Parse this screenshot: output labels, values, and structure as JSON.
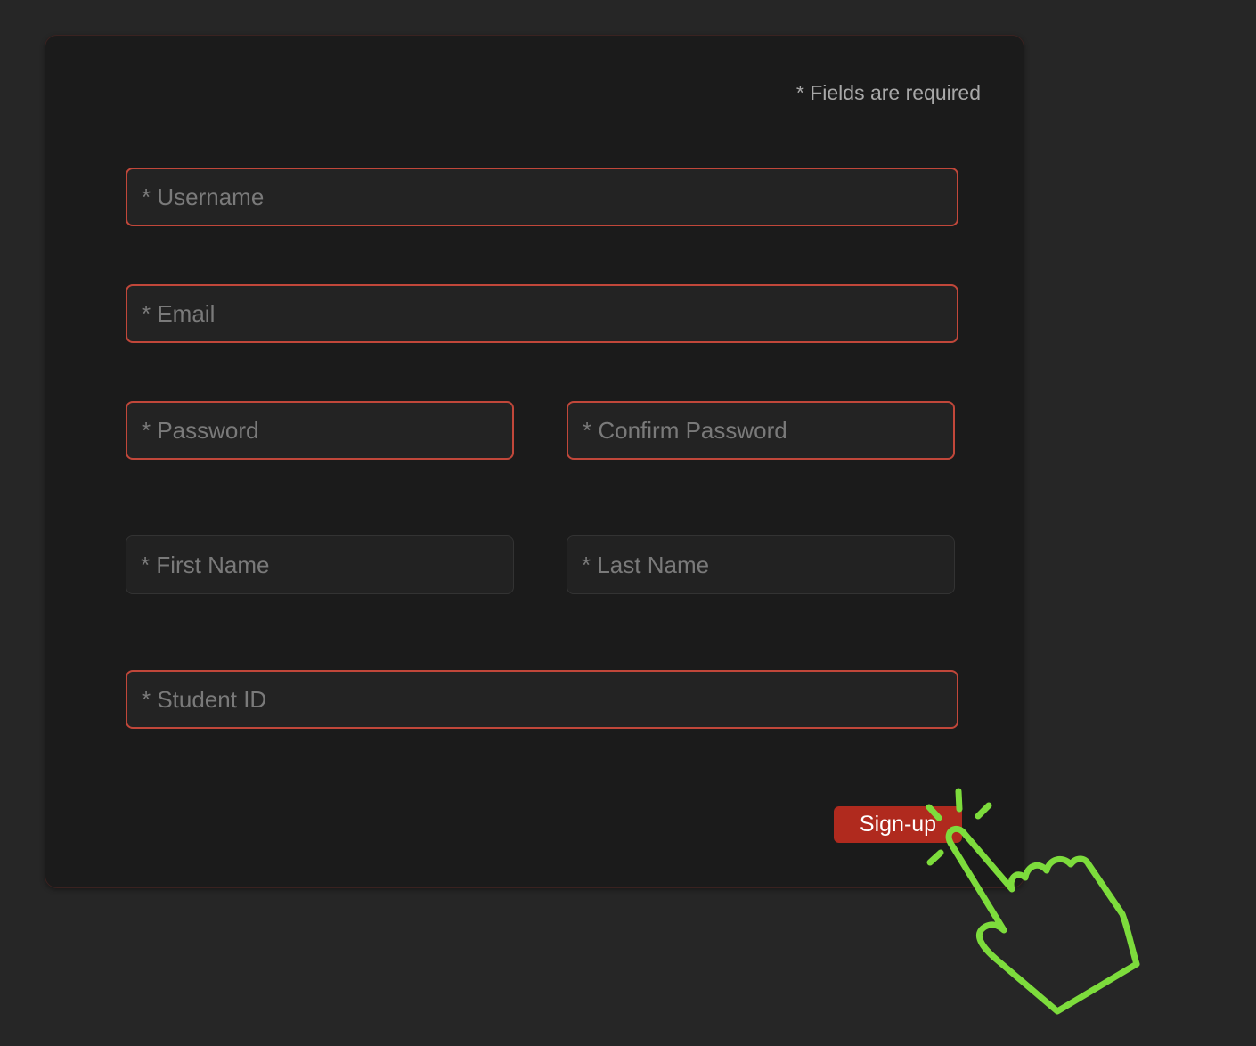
{
  "form": {
    "required_note": "* Fields are required",
    "fields": {
      "username": {
        "placeholder": "* Username",
        "value": ""
      },
      "email": {
        "placeholder": "* Email",
        "value": ""
      },
      "password": {
        "placeholder": "* Password",
        "value": ""
      },
      "confirm_password": {
        "placeholder": "* Confirm Password",
        "value": ""
      },
      "first_name": {
        "placeholder": "* First Name",
        "value": ""
      },
      "last_name": {
        "placeholder": "* Last Name",
        "value": ""
      },
      "student_id": {
        "placeholder": "* Student ID",
        "value": ""
      }
    },
    "submit_label": "Sign-up"
  },
  "colors": {
    "page_background": "#262626",
    "card_background": "#1b1b1b",
    "error_border": "#c1473a",
    "button_background": "#b02a1e",
    "cursor_hint": "#7ddc3c"
  },
  "icons": {
    "cursor": "pointing-hand-click-icon"
  }
}
